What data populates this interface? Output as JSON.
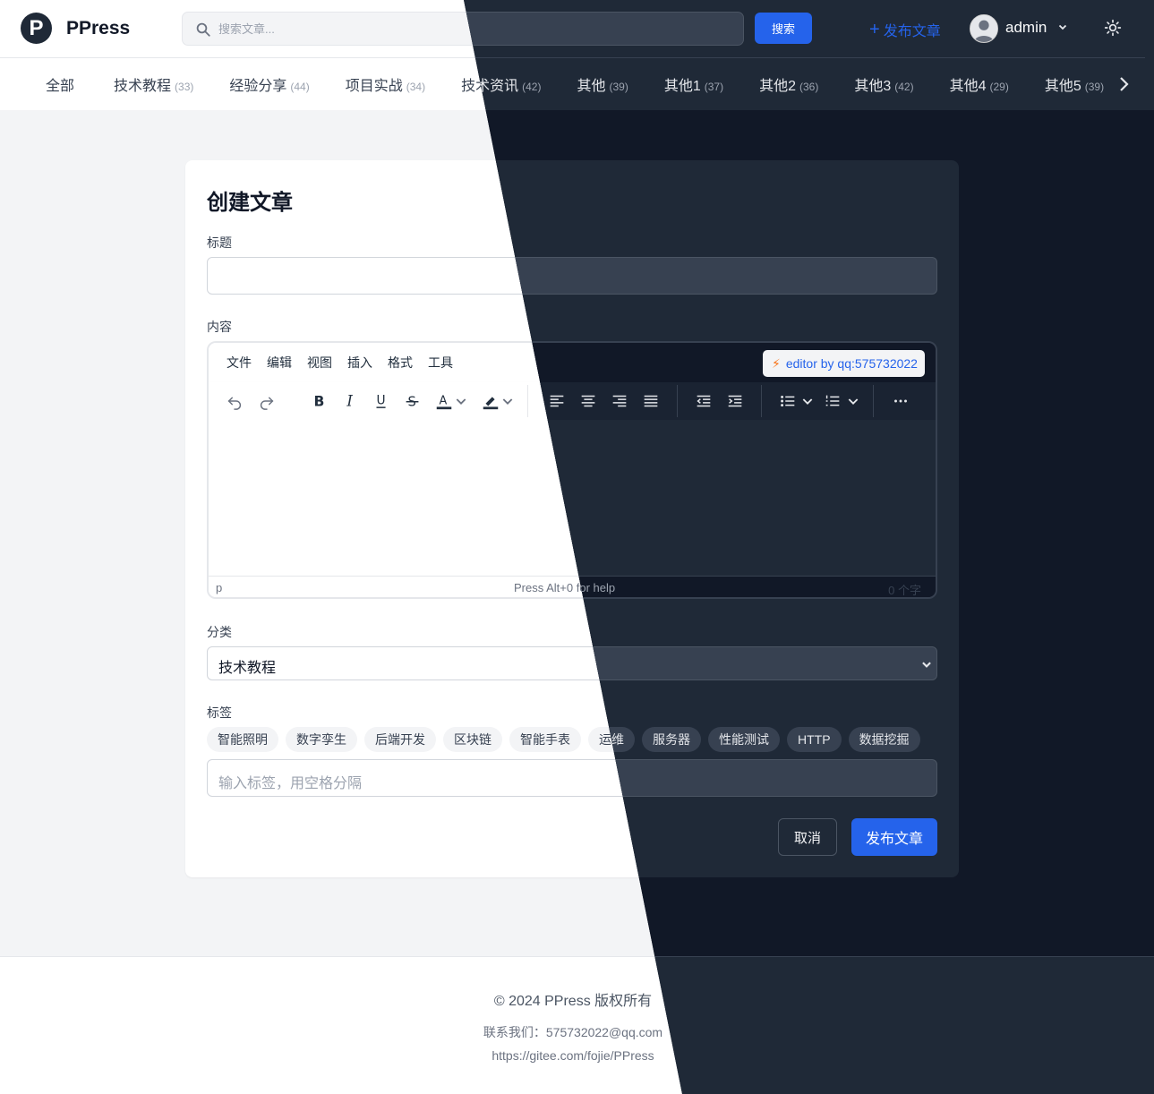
{
  "app": {
    "brand": "PPress",
    "logo_letter": "P"
  },
  "header": {
    "search_placeholder": "搜索文章...",
    "search_button": "搜索",
    "publish_link": "发布文章",
    "username": "admin"
  },
  "categories": [
    {
      "label": "全部",
      "count": ""
    },
    {
      "label": "技术教程",
      "count": "(33)"
    },
    {
      "label": "经验分享",
      "count": "(44)"
    },
    {
      "label": "项目实战",
      "count": "(34)"
    },
    {
      "label": "技术资讯",
      "count": "(42)"
    },
    {
      "label": "其他",
      "count": "(39)"
    },
    {
      "label": "其他1",
      "count": "(37)"
    },
    {
      "label": "其他2",
      "count": "(36)"
    },
    {
      "label": "其他3",
      "count": "(42)"
    },
    {
      "label": "其他4",
      "count": "(29)"
    },
    {
      "label": "其他5",
      "count": "(39)"
    }
  ],
  "form": {
    "heading": "创建文章",
    "title_label": "标题",
    "content_label": "内容",
    "category_label": "分类",
    "category_value": "技术教程",
    "tags_label": "标签",
    "tag_input_placeholder": "输入标签，用空格分隔",
    "cancel_button": "取消",
    "publish_button": "发布文章"
  },
  "editor": {
    "menu": [
      "文件",
      "编辑",
      "视图",
      "插入",
      "格式",
      "工具"
    ],
    "badge": "editor by qq:575732022",
    "status_path": "p",
    "status_help": "Press Alt+0 for help",
    "status_count": "0 个字"
  },
  "tags": [
    "智能照明",
    "数字孪生",
    "后端开发",
    "区块链",
    "智能手表",
    "运维",
    "服务器",
    "性能测试",
    "HTTP",
    "数据挖掘"
  ],
  "footer": {
    "copyright": "© 2024 PPress 版权所有",
    "contact": "联系我们：575732022@qq.com",
    "url": "https://gitee.com/fojie/PPress"
  },
  "colors": {
    "accent": "#2563eb",
    "badge_bolt": "#f97316"
  }
}
